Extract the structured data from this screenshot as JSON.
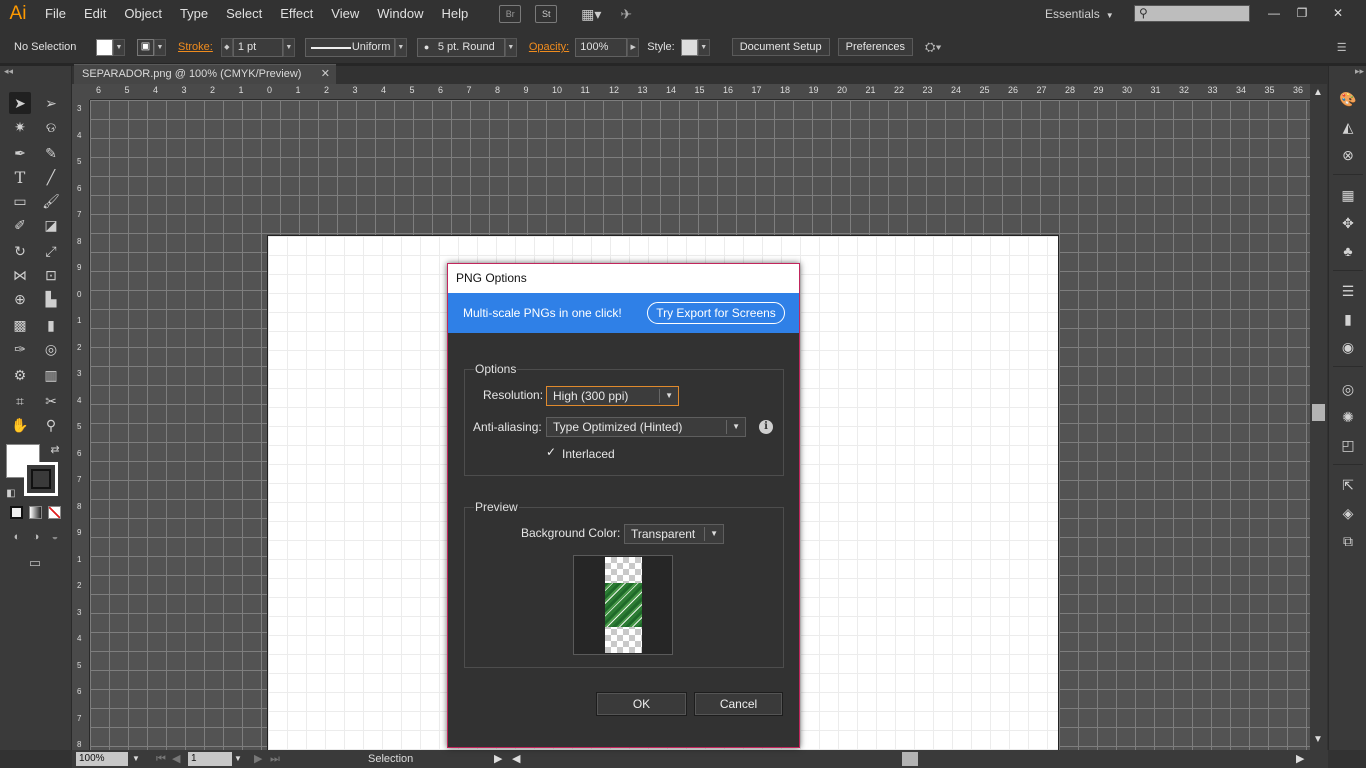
{
  "app": {
    "logo": "Ai"
  },
  "menu": [
    "File",
    "Edit",
    "Object",
    "Type",
    "Select",
    "Effect",
    "View",
    "Window",
    "Help"
  ],
  "menubar_icons": {
    "bridge": "Br",
    "stock": "St"
  },
  "workspace": {
    "label": "Essentials"
  },
  "search": {
    "placeholder": ""
  },
  "control_bar": {
    "selection": "No Selection",
    "stroke_label": "Stroke:",
    "stroke_value": "1 pt",
    "profile": "Uniform",
    "brush": "5 pt. Round",
    "opacity_label": "Opacity:",
    "opacity_value": "100%",
    "style_label": "Style:",
    "document_setup": "Document Setup",
    "preferences": "Preferences"
  },
  "document_tab": {
    "title": "SEPARADOR.png @ 100% (CMYK/Preview)"
  },
  "rulers": {
    "horizontal": [
      "6",
      "5",
      "4",
      "3",
      "2",
      "1",
      "0",
      "1",
      "2",
      "3",
      "4",
      "5",
      "6",
      "7",
      "8",
      "9",
      "10",
      "11",
      "12",
      "13",
      "14",
      "15",
      "16",
      "17",
      "18",
      "19",
      "20",
      "21",
      "22",
      "23",
      "24",
      "25",
      "26",
      "27",
      "28",
      "29",
      "30",
      "31",
      "32",
      "33",
      "34",
      "35",
      "36"
    ],
    "vertical": [
      "3",
      "4",
      "5",
      "6",
      "7",
      "8",
      "9",
      "0",
      "1",
      "2",
      "3",
      "4",
      "5",
      "6",
      "7",
      "8",
      "9",
      "1",
      "2",
      "3",
      "4",
      "5",
      "6",
      "7",
      "8"
    ]
  },
  "status_bar": {
    "zoom": "100%",
    "artboard": "1",
    "tool": "Selection"
  },
  "dialog": {
    "title": "PNG Options",
    "banner_text": "Multi-scale PNGs in one click!",
    "banner_button": "Try Export for Screens",
    "options_group": "Options",
    "resolution_label": "Resolution:",
    "resolution_value": "High (300 ppi)",
    "antialias_label": "Anti-aliasing:",
    "antialias_value": "Type Optimized (Hinted)",
    "interlaced_label": "Interlaced",
    "interlaced_checked": true,
    "preview_group": "Preview",
    "bg_color_label": "Background Color:",
    "bg_color_value": "Transparent",
    "ok": "OK",
    "cancel": "Cancel"
  },
  "colors": {
    "accent": "#2f80e7",
    "dialog_border": "#c2255c",
    "brand": "#ff9a00",
    "focus": "#e08a2d"
  }
}
